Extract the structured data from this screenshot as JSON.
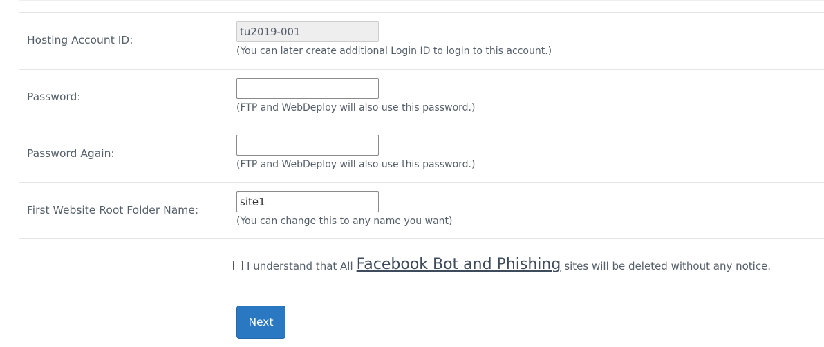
{
  "form": {
    "rows": [
      {
        "label": "Hosting Account ID:",
        "value": "tu2019-001",
        "hint": "(You can later create additional Login ID to login to this account.)"
      },
      {
        "label": "Password:",
        "value": "",
        "hint": "(FTP and WebDeploy will also use this password.)"
      },
      {
        "label": "Password Again:",
        "value": "",
        "hint": "(FTP and WebDeploy will also use this password.)"
      },
      {
        "label": "First Website Root Folder Name:",
        "value": "site1",
        "hint": "(You can change this to any name you want)"
      }
    ],
    "agreement": {
      "checked": false,
      "prefix": "I understand that All",
      "link": "Facebook Bot and Phishing",
      "suffix": "sites will be deleted without any notice."
    },
    "next_label": "Next"
  },
  "colors": {
    "accent": "#2a78c2",
    "text": "#555f6a",
    "border": "#e4e4e4"
  }
}
